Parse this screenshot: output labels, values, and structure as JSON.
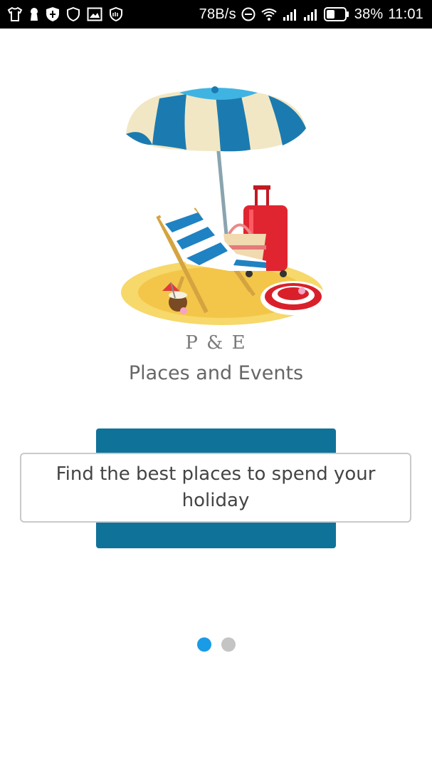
{
  "status_bar": {
    "left_icons": [
      "tshirt-icon",
      "keyhole-icon",
      "shield-filled-icon",
      "shield-outline-icon",
      "image-icon",
      "shield-badge-icon"
    ],
    "net_speed": "78B/s",
    "battery_percent": "38%",
    "time": "11:01"
  },
  "logo": {
    "text": "P & E"
  },
  "app": {
    "name": "Places and Events"
  },
  "onboarding": {
    "message": "Find the best places to spend your holiday",
    "panel_color": "#0f7299"
  },
  "pager": {
    "pages": 2,
    "active_index": 0,
    "active_color": "#1a9be6",
    "inactive_color": "#c4c4c4"
  }
}
